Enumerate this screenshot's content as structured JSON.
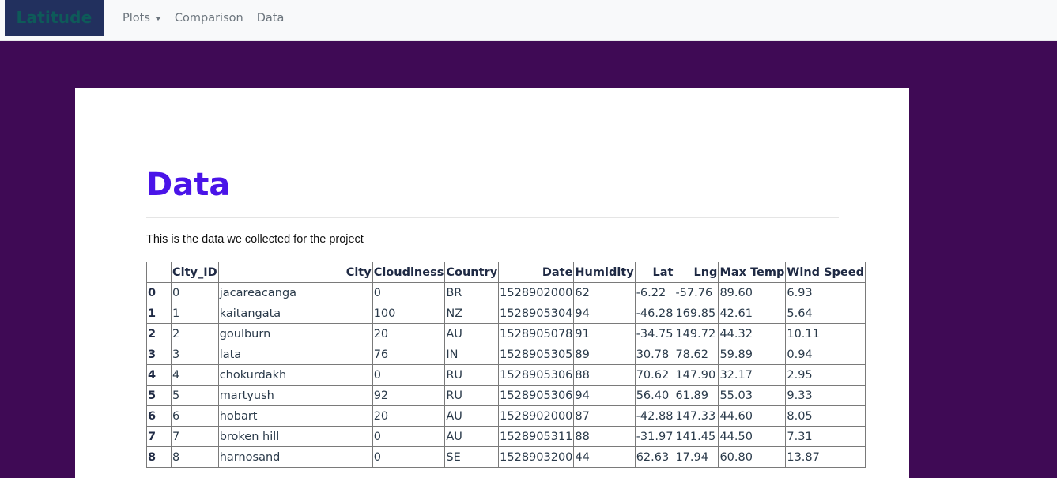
{
  "nav": {
    "brand": "Latitude",
    "links": [
      {
        "label": "Plots",
        "has_dropdown": true
      },
      {
        "label": "Comparison"
      },
      {
        "label": "Data"
      }
    ]
  },
  "colors": {
    "page_background": "#3f0a55",
    "navbar_background": "#f8f9fa",
    "brand_background": "#22305e",
    "brand_text": "#0e5a59",
    "title": "#4a14e8"
  },
  "main": {
    "title": "Data",
    "intro": "This is the data we collected for the project"
  },
  "table": {
    "columns": [
      "",
      "City_ID",
      "City",
      "Cloudiness",
      "Country",
      "Date",
      "Humidity",
      "Lat",
      "Lng",
      "Max Temp",
      "Wind Speed"
    ],
    "rows": [
      [
        "0",
        "0",
        "jacareacanga",
        "0",
        "BR",
        "1528902000",
        "62",
        "-6.22",
        "-57.76",
        "89.60",
        "6.93"
      ],
      [
        "1",
        "1",
        "kaitangata",
        "100",
        "NZ",
        "1528905304",
        "94",
        "-46.28",
        "169.85",
        "42.61",
        "5.64"
      ],
      [
        "2",
        "2",
        "goulburn",
        "20",
        "AU",
        "1528905078",
        "91",
        "-34.75",
        "149.72",
        "44.32",
        "10.11"
      ],
      [
        "3",
        "3",
        "lata",
        "76",
        "IN",
        "1528905305",
        "89",
        "30.78",
        "78.62",
        "59.89",
        "0.94"
      ],
      [
        "4",
        "4",
        "chokurdakh",
        "0",
        "RU",
        "1528905306",
        "88",
        "70.62",
        "147.90",
        "32.17",
        "2.95"
      ],
      [
        "5",
        "5",
        "martyush",
        "92",
        "RU",
        "1528905306",
        "94",
        "56.40",
        "61.89",
        "55.03",
        "9.33"
      ],
      [
        "6",
        "6",
        "hobart",
        "20",
        "AU",
        "1528902000",
        "87",
        "-42.88",
        "147.33",
        "44.60",
        "8.05"
      ],
      [
        "7",
        "7",
        "broken hill",
        "0",
        "AU",
        "1528905311",
        "88",
        "-31.97",
        "141.45",
        "44.50",
        "7.31"
      ],
      [
        "8",
        "8",
        "harnosand",
        "0",
        "SE",
        "1528903200",
        "44",
        "62.63",
        "17.94",
        "60.80",
        "13.87"
      ]
    ]
  }
}
